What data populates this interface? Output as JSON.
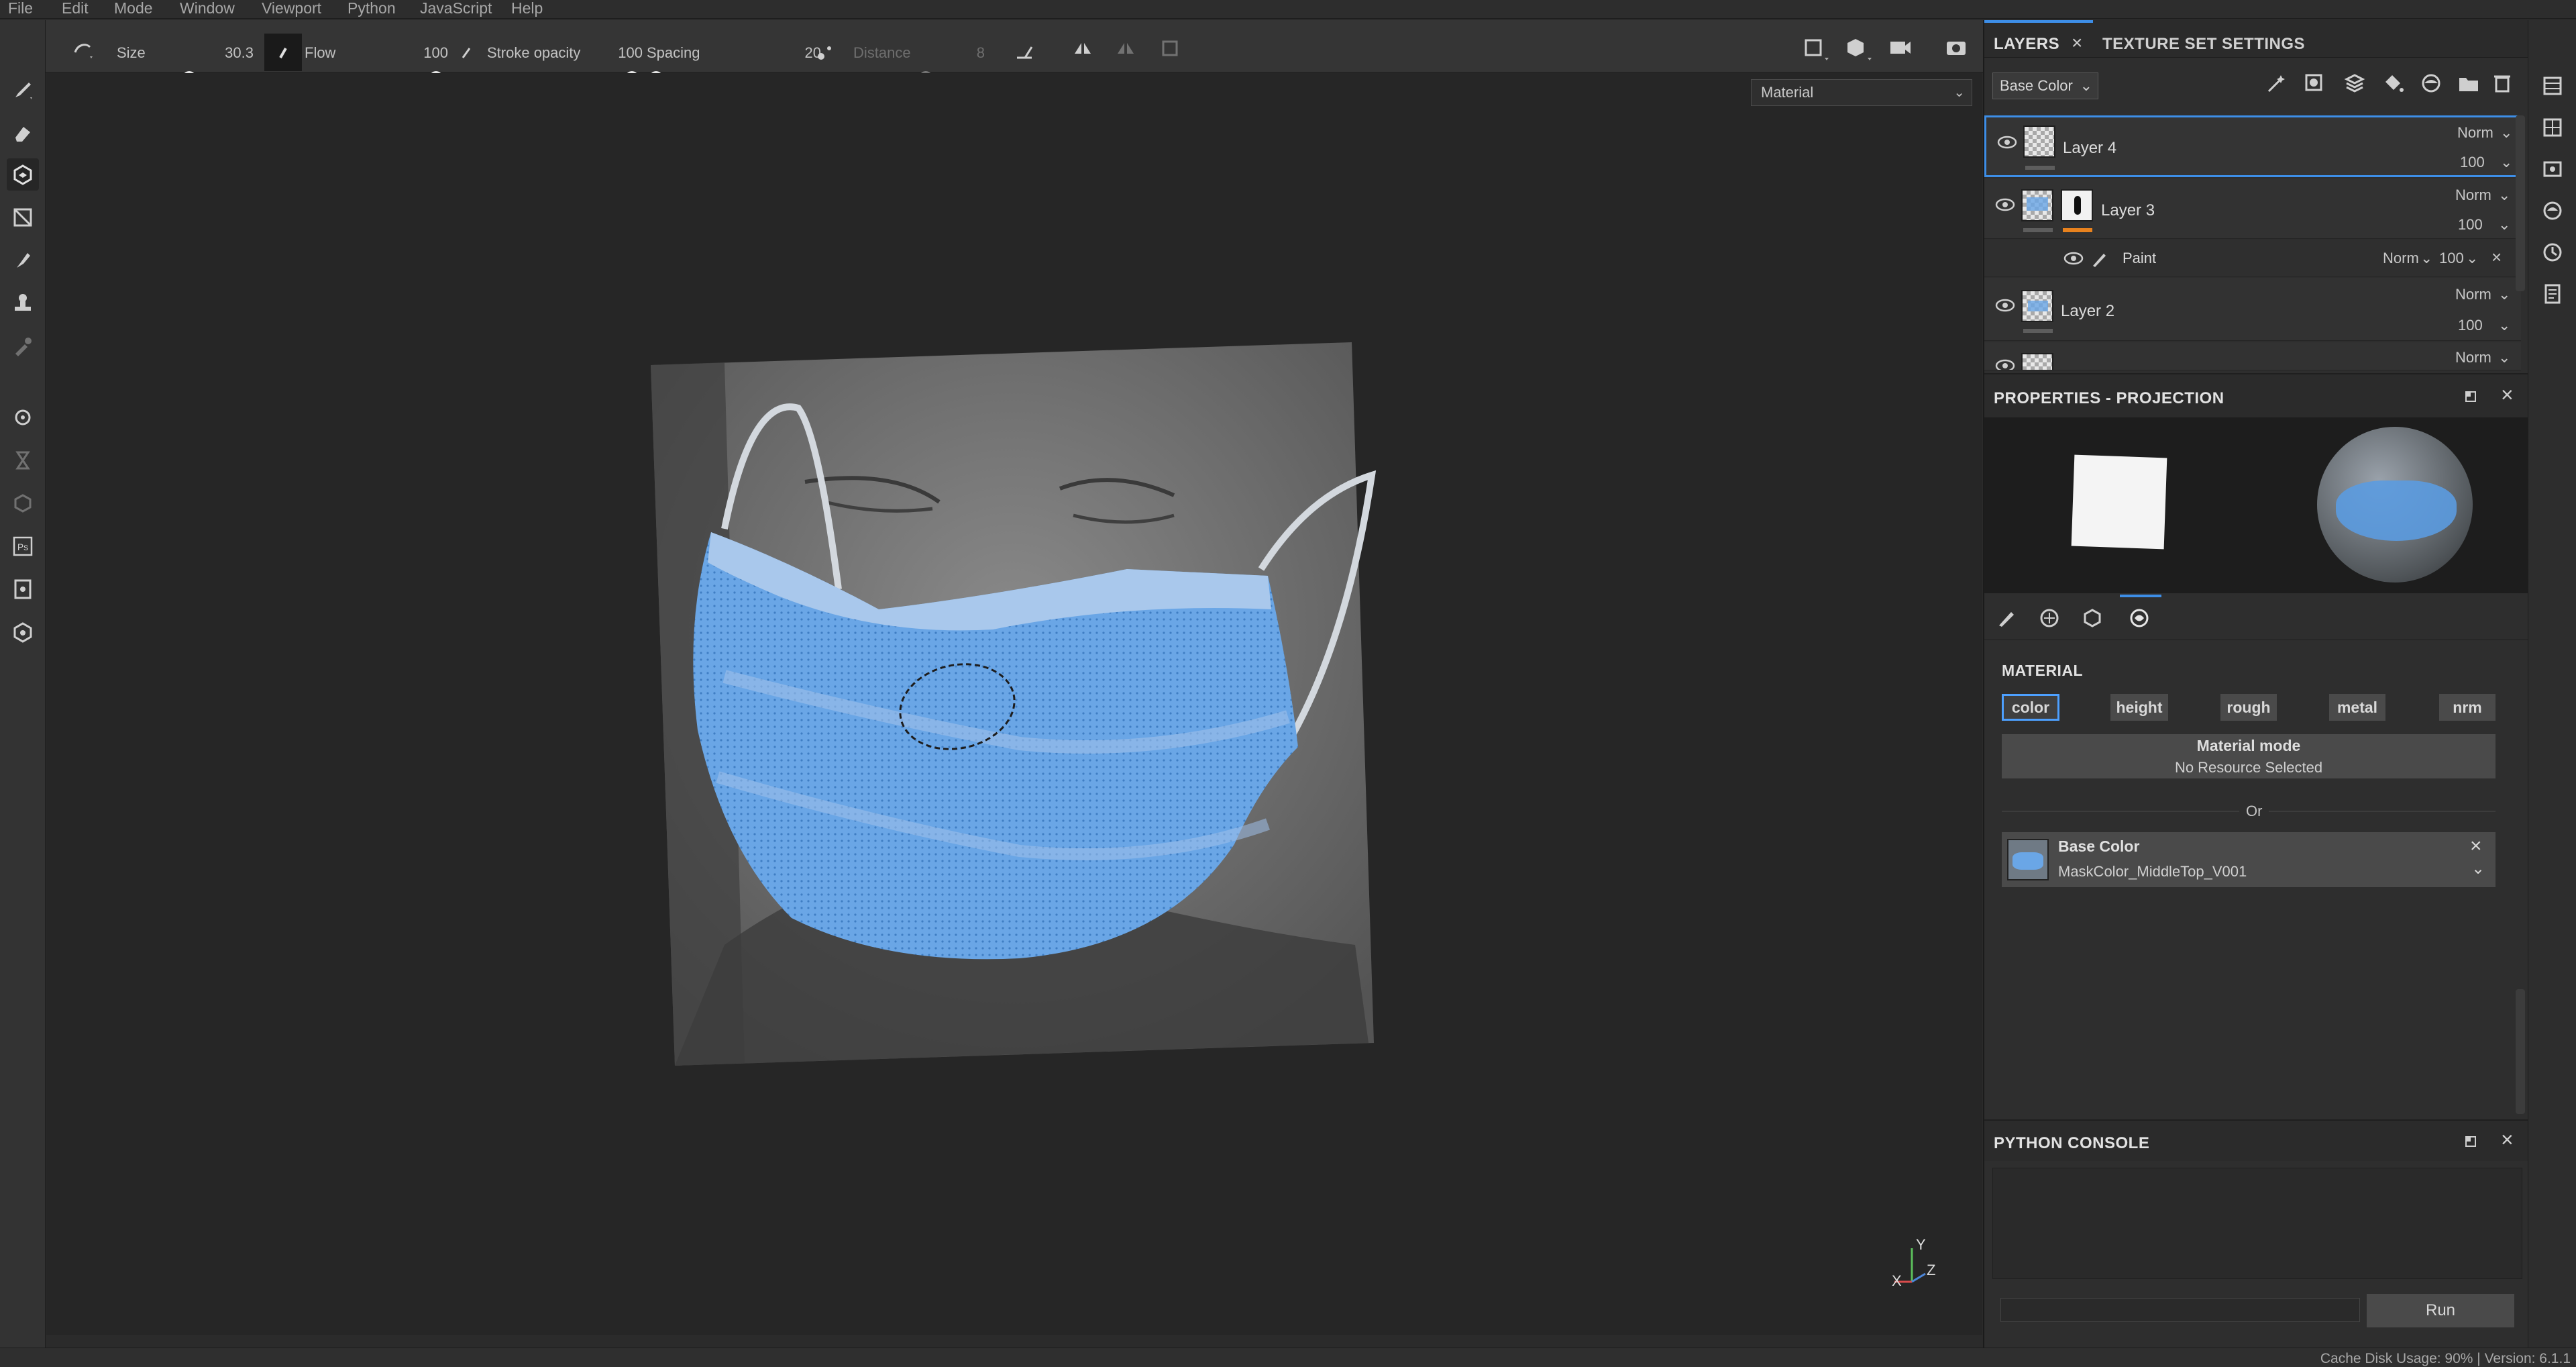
{
  "menu": [
    "File",
    "Edit",
    "Mode",
    "Window",
    "Viewport",
    "Python",
    "JavaScript",
    "Help"
  ],
  "toolbar": {
    "size_label": "Size",
    "size_value": "30.3",
    "flow_label": "Flow",
    "flow_value": "100",
    "stroke_opacity_label": "Stroke opacity",
    "stroke_opacity_value": "100",
    "spacing_label": "Spacing",
    "spacing_value": "20",
    "distance_label": "Distance",
    "distance_value": "8"
  },
  "viewport": {
    "mode_select": "Material"
  },
  "layers_panel": {
    "tab_layers": "LAYERS",
    "tab_texture_set": "TEXTURE SET SETTINGS",
    "channel_select": "Base Color",
    "layers": [
      {
        "name": "Layer 4",
        "blend": "Norm",
        "opacity": "100"
      },
      {
        "name": "Layer 3",
        "blend": "Norm",
        "opacity": "100"
      },
      {
        "name": "Paint",
        "blend": "Norm",
        "opacity": "100"
      },
      {
        "name": "Layer 2",
        "blend": "Norm",
        "opacity": "100"
      },
      {
        "name": "",
        "blend": "Norm",
        "opacity": ""
      }
    ]
  },
  "properties": {
    "title": "PROPERTIES - PROJECTION",
    "material_heading": "MATERIAL",
    "channels": [
      "color",
      "height",
      "rough",
      "metal",
      "nrm"
    ],
    "material_mode_title": "Material mode",
    "material_mode_value": "No Resource Selected",
    "or_label": "Or",
    "base_color_title": "Base Color",
    "base_color_resource": "MaskColor_MiddleTop_V001"
  },
  "console": {
    "title": "PYTHON CONSOLE",
    "run_label": "Run"
  },
  "status": {
    "text": "Cache Disk Usage: 90% | Version: 6.1.1"
  },
  "colors": {
    "accent": "#3d8ee7",
    "mask_blue": "#5b9be0",
    "layer3_bar": "#e8821e"
  }
}
